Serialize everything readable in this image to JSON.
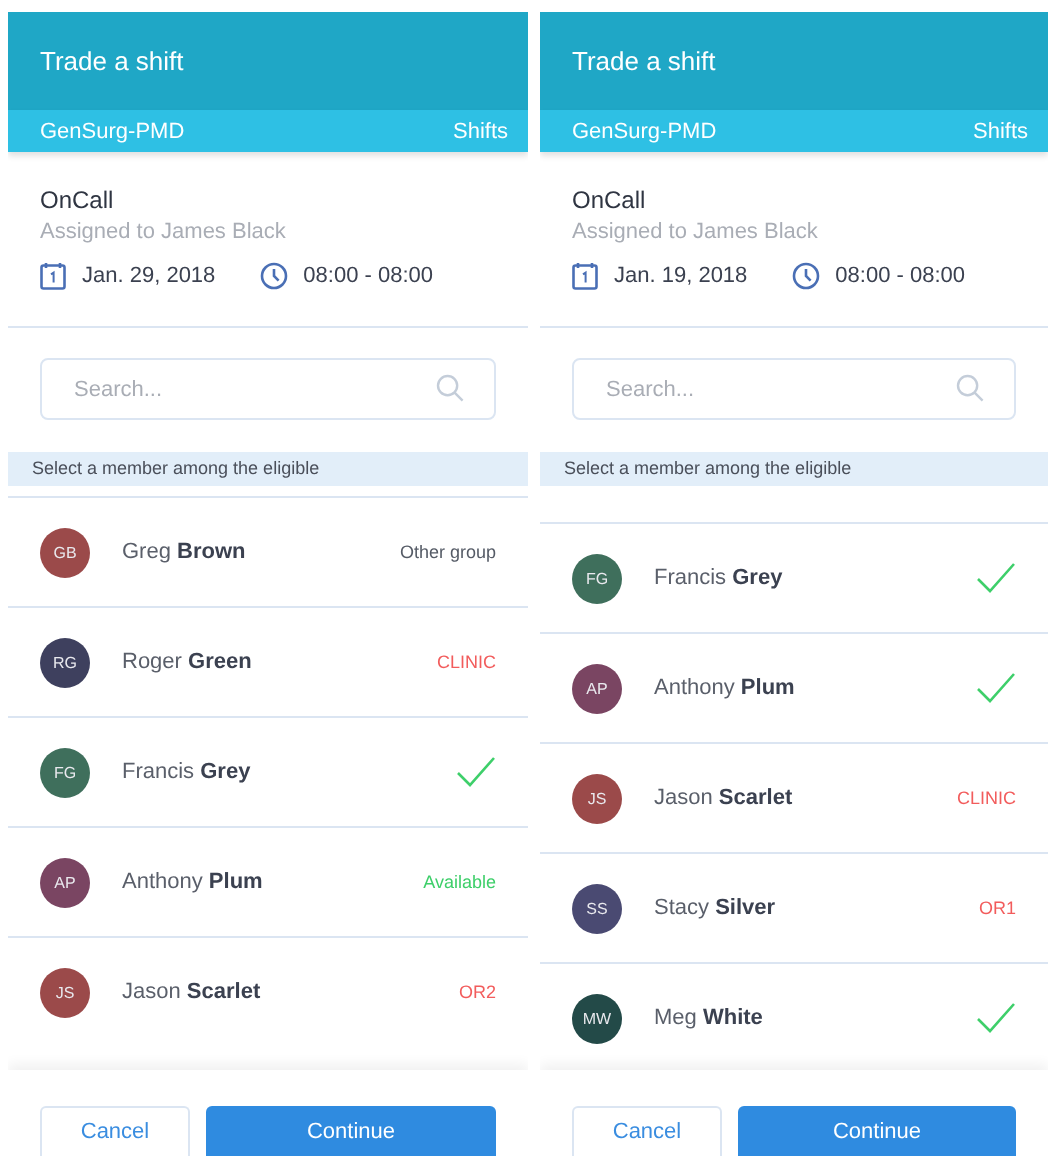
{
  "screens": [
    {
      "title": "Trade a shift",
      "group": "GenSurg-PMD",
      "section": "Shifts",
      "shift": {
        "name": "OnCall",
        "assigned": "Assigned to James Black",
        "date": "Jan. 29, 2018",
        "time": "08:00 - 08:00"
      },
      "search": {
        "placeholder": "Search..."
      },
      "hint": "Select a member among the eligible",
      "members": [
        {
          "initials": "GB",
          "name": "Greg **Brown**",
          "color": "#9b4a4a",
          "status": {
            "kind": "text",
            "text": "Other group",
            "color": "#555b66"
          }
        },
        {
          "initials": "RG",
          "name": "Roger **Green**",
          "color": "#3e405e",
          "status": {
            "kind": "text",
            "text": "CLINIC",
            "color": "#f25c5c"
          }
        },
        {
          "initials": "FG",
          "name": "Francis **Grey**",
          "color": "#3f6f5c",
          "status": {
            "kind": "check"
          }
        },
        {
          "initials": "AP",
          "name": "Anthony **Plum**",
          "color": "#7a4562",
          "status": {
            "kind": "text",
            "text": "Available",
            "color": "#3ecf6a"
          }
        },
        {
          "initials": "JS",
          "name": "Jason **Scarlet**",
          "color": "#9b4a4a",
          "status": {
            "kind": "text",
            "text": "OR2",
            "color": "#f25c5c"
          }
        }
      ],
      "buttons": [
        {
          "kind": "secondary",
          "label": "Cancel"
        },
        {
          "kind": "primary",
          "label": "Continue"
        }
      ]
    },
    {
      "title": "Trade a shift",
      "group": "GenSurg-PMD",
      "section": "Shifts",
      "shift": {
        "name": "OnCall",
        "assigned": "Assigned to James Black",
        "date": "Jan. 19, 2018",
        "time": "08:00 - 08:00"
      },
      "search": {
        "placeholder": "Search..."
      },
      "hint": "Select a member among the eligible",
      "members": [
        {
          "initials": "FG",
          "name": "Francis **Grey**",
          "color": "#3f6f5c",
          "status": {
            "kind": "check"
          }
        },
        {
          "initials": "AP",
          "name": "Anthony **Plum**",
          "color": "#7a4562",
          "status": {
            "kind": "check"
          }
        },
        {
          "initials": "JS",
          "name": "Jason **Scarlet**",
          "color": "#9b4a4a",
          "status": {
            "kind": "text",
            "text": "CLINIC",
            "color": "#f25c5c"
          }
        },
        {
          "initials": "SS",
          "name": "Stacy **Silver**",
          "color": "#4a4a72",
          "status": {
            "kind": "text",
            "text": "OR1",
            "color": "#f25c5c"
          }
        },
        {
          "initials": "MW",
          "name": "Meg **White**",
          "color": "#234a48",
          "status": {
            "kind": "check"
          }
        }
      ],
      "buttons": [
        {
          "kind": "secondary",
          "label": "Cancel"
        },
        {
          "kind": "primary",
          "label": "Continue"
        }
      ]
    }
  ]
}
